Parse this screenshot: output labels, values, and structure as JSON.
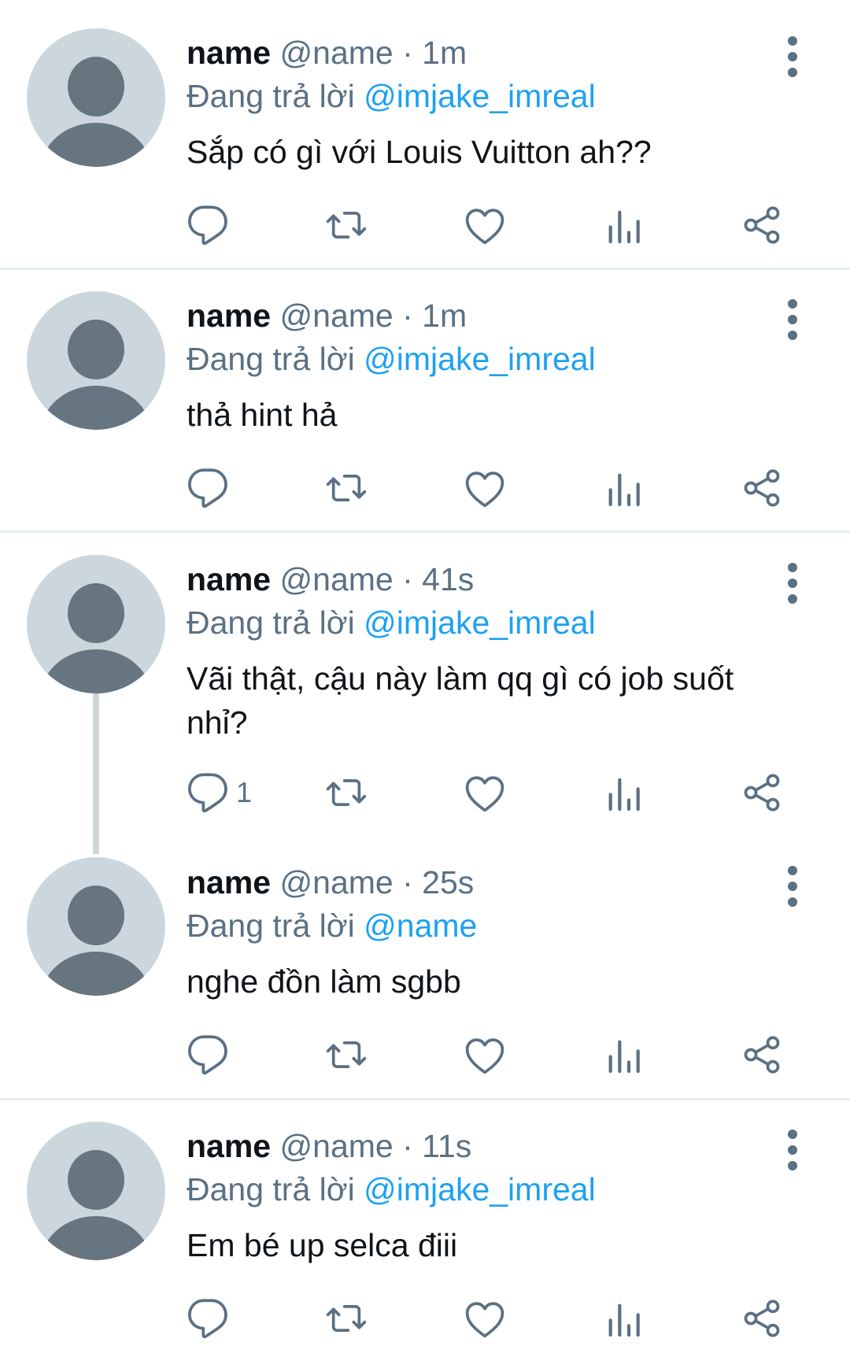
{
  "tweets": [
    {
      "display_name": "name",
      "handle": "@name",
      "time": "1m",
      "replying_prefix": "Đang trả lời",
      "replying_to": "@imjake_imreal",
      "text": "Sắp có gì với Louis Vuitton ah??",
      "reply_count": ""
    },
    {
      "display_name": "name",
      "handle": "@name",
      "time": "1m",
      "replying_prefix": "Đang trả lời",
      "replying_to": "@imjake_imreal",
      "text": "thả hint hả",
      "reply_count": ""
    },
    {
      "display_name": "name",
      "handle": "@name",
      "time": "41s",
      "replying_prefix": "Đang trả lời",
      "replying_to": "@imjake_imreal",
      "text": "Vãi thật, cậu này làm qq gì có job suốt nhỉ?",
      "reply_count": "1"
    },
    {
      "display_name": "name",
      "handle": "@name",
      "time": "25s",
      "replying_prefix": "Đang trả lời",
      "replying_to": "@name",
      "text": "nghe đồn làm sgbb",
      "reply_count": ""
    },
    {
      "display_name": "name",
      "handle": "@name",
      "time": "11s",
      "replying_prefix": "Đang trả lời",
      "replying_to": "@imjake_imreal",
      "text": "Em bé up selca điii",
      "reply_count": ""
    }
  ],
  "separator": "·",
  "icons": {
    "reply": "reply-icon",
    "retweet": "retweet-icon",
    "like": "heart-icon",
    "analytics": "analytics-icon",
    "share": "share-icon",
    "more": "more-vertical-icon"
  },
  "colors": {
    "link": "#1da1f2",
    "secondary_text": "#5b7083",
    "avatar_bg": "#ccd6dd",
    "avatar_fg": "#66757f",
    "divider": "#e6ecf0"
  }
}
